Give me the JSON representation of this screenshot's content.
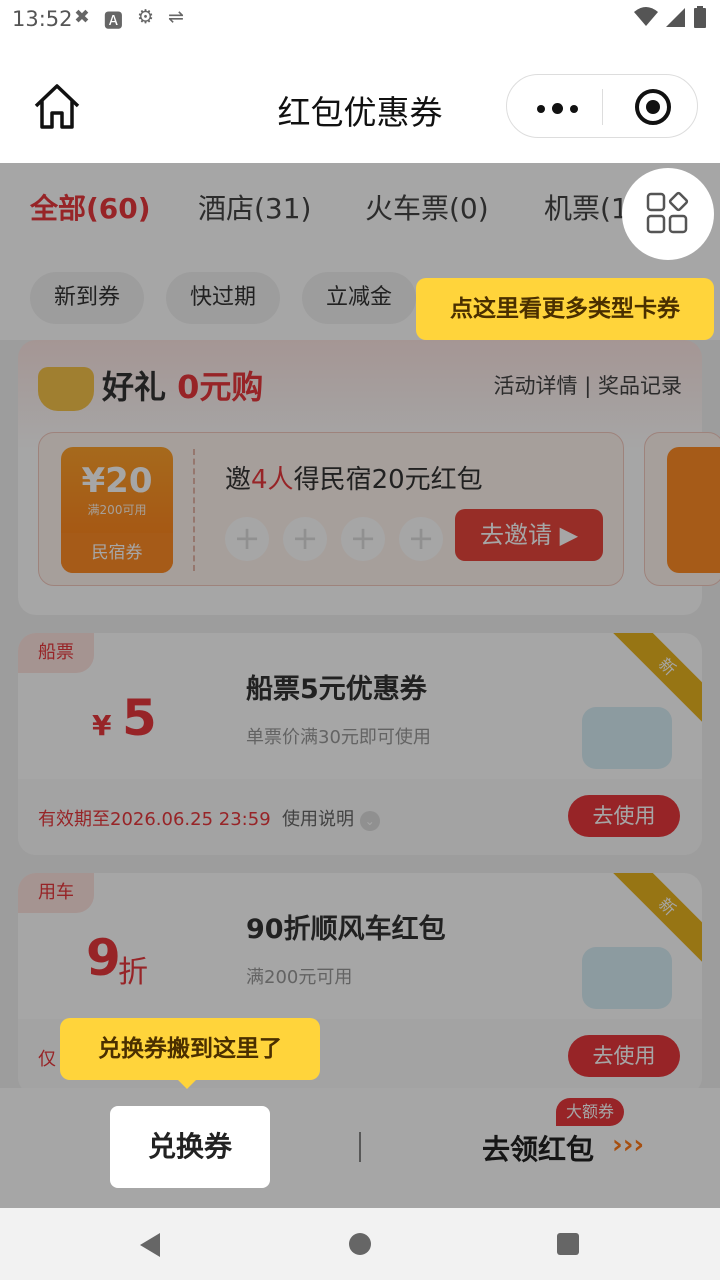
{
  "status": {
    "time": "13:52"
  },
  "nav": {
    "title": "红包优惠券"
  },
  "tabs": [
    {
      "label": "全部(60)"
    },
    {
      "label": "酒店(31)"
    },
    {
      "label": "火车票(0)"
    },
    {
      "label": "机票(1"
    }
  ],
  "chips": [
    "新到券",
    "快过期",
    "立减金"
  ],
  "promo": {
    "brand_main": "好礼",
    "brand_highlight": "0元购",
    "link_details": "活动详情",
    "link_records": "奖品记录",
    "coupon": {
      "amount": "¥20",
      "condition": "满200可用",
      "type": "民宿券"
    },
    "invite_prefix": "邀",
    "invite_count": "4人",
    "invite_suffix": "得民宿20元红包",
    "invite_button": "去邀请 ▶"
  },
  "coupons": [
    {
      "tag": "船票",
      "prefix": "¥",
      "value": "5",
      "unit": "",
      "name": "船票5元优惠券",
      "desc": "单票价满30元即可使用",
      "expiry": "有效期至2026.06.25 23:59",
      "usage": "使用说明",
      "button": "去使用",
      "ribbon": "新"
    },
    {
      "tag": "用车",
      "prefix": "",
      "value": "9",
      "unit": "折",
      "name": "90折顺风车红包",
      "desc": "满200元可用",
      "expiry": "仅",
      "usage": "",
      "button": "去使用",
      "ribbon": "新"
    }
  ],
  "tooltips": {
    "more_types": "点这里看更多类型卡券",
    "exchange_moved": "兑换券搬到这里了"
  },
  "toolbar": {
    "exchange": "兑换券",
    "get_redpacket": "去领红包",
    "badge": "大额券"
  }
}
